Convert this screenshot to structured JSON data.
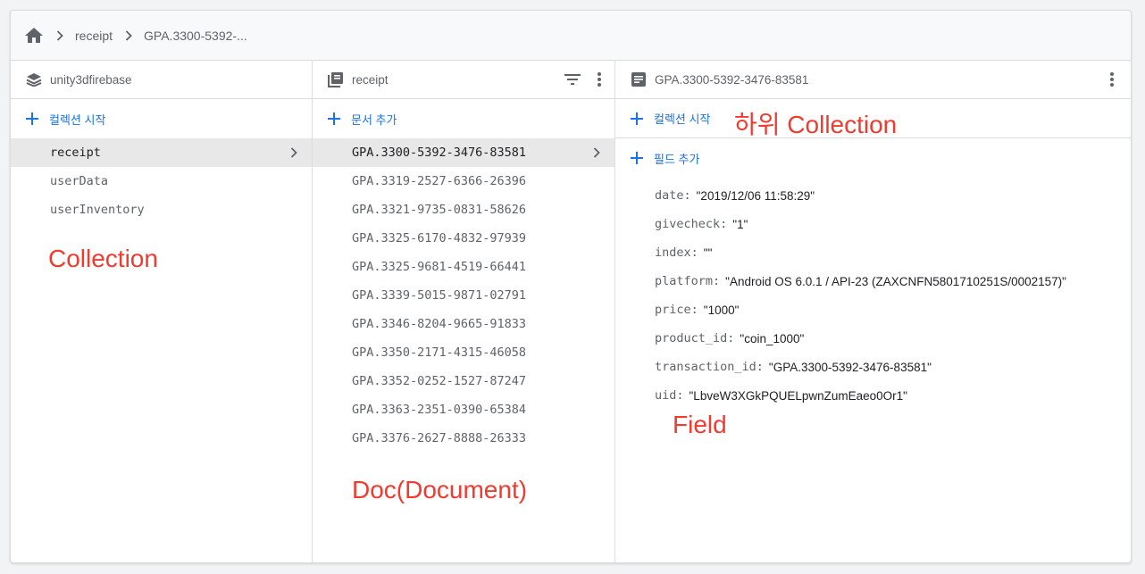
{
  "breadcrumb": {
    "items": [
      "receipt",
      "GPA.3300-5392-..."
    ]
  },
  "columns": {
    "root": {
      "title": "unity3dfirebase",
      "add_label": "컬렉션 시작",
      "items": [
        "receipt",
        "userData",
        "userInventory"
      ],
      "selected": "receipt"
    },
    "collection": {
      "title": "receipt",
      "add_label": "문서 추가",
      "items": [
        "GPA.3300-5392-3476-83581",
        "GPA.3319-2527-6366-26396",
        "GPA.3321-9735-0831-58626",
        "GPA.3325-6170-4832-97939",
        "GPA.3325-9681-4519-66441",
        "GPA.3339-5015-9871-02791",
        "GPA.3346-8204-9665-91833",
        "GPA.3350-2171-4315-46058",
        "GPA.3352-0252-1527-87247",
        "GPA.3363-2351-0390-65384",
        "GPA.3376-2627-8888-26333"
      ],
      "selected": "GPA.3300-5392-3476-83581"
    },
    "document": {
      "title": "GPA.3300-5392-3476-83581",
      "add_collection_label": "컬렉션 시작",
      "add_field_label": "필드 추가",
      "fields": [
        {
          "key": "date:",
          "value": "\"2019/12/06 11:58:29\""
        },
        {
          "key": "givecheck:",
          "value": "\"1\""
        },
        {
          "key": "index:",
          "value": "\"\""
        },
        {
          "key": "platform:",
          "value": "\"Android OS 6.0.1 / API-23 (ZAXCNFN5801710251S/0002157)\""
        },
        {
          "key": "price:",
          "value": "\"1000\""
        },
        {
          "key": "product_id:",
          "value": "\"coin_1000\""
        },
        {
          "key": "transaction_id:",
          "value": "\"GPA.3300-5392-3476-83581\""
        },
        {
          "key": "uid:",
          "value": "\"LbveW3XGkPQUELpwnZumEaeo0Or1\""
        }
      ]
    }
  },
  "annotations": {
    "collection": "Collection",
    "document": "Doc(Document)",
    "sub_collection": "하위 Collection",
    "field": "Field"
  },
  "colors": {
    "accent": "#1a73e8",
    "annotation": "#f23a2f",
    "selected_bg": "#e8e8e8"
  }
}
